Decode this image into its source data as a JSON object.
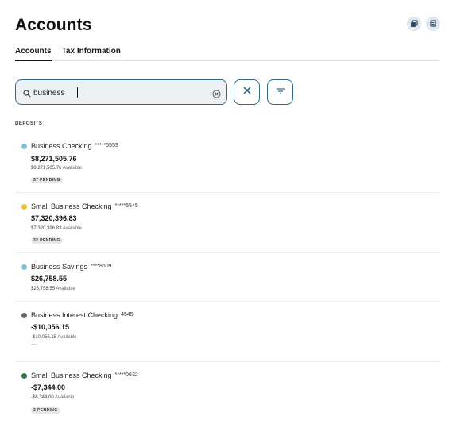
{
  "header": {
    "title": "Accounts",
    "icons": [
      "copy-icon",
      "print-icon"
    ]
  },
  "tabs": [
    {
      "label": "Accounts",
      "active": true
    },
    {
      "label": "Tax Information",
      "active": false
    }
  ],
  "search": {
    "value": "business",
    "icon": "search-icon",
    "clear_icon": "clear-circle-icon"
  },
  "actions": {
    "close_icon": "close-icon",
    "filter_icon": "filter-icon"
  },
  "section": {
    "label": "DEPOSITS"
  },
  "accounts": [
    {
      "name": "Business Checking",
      "mask": "*****5553",
      "balance": "$8,271,505.76",
      "available": "$8,271,505.76",
      "available_label": "Available",
      "pending": "37 PENDING",
      "dot_color": "#7cc4dc"
    },
    {
      "name": "Small Business Checking",
      "mask": "*****5545",
      "balance": "$7,320,396.83",
      "available": "$7,320,396.83",
      "available_label": "Available",
      "pending": "32 PENDING",
      "dot_color": "#f0c22e"
    },
    {
      "name": "Business Savings",
      "mask": "****8509",
      "balance": "$26,758.55",
      "available": "$26,758.55",
      "available_label": "Available",
      "pending": "",
      "dot_color": "#7cc4dc"
    },
    {
      "name": "Business Interest Checking",
      "mask": "4545",
      "balance": "-$10,056.15",
      "available": "-$10,056.15",
      "available_label": "Available",
      "pending": "",
      "extra": "---",
      "dot_color": "#666666"
    },
    {
      "name": "Small Business Checking",
      "mask": "*****0632",
      "balance": "-$7,344.00",
      "available": "-$6,344.00",
      "available_label": "Available",
      "pending": "2 PENDING",
      "dot_color": "#2a7a43"
    }
  ],
  "colors": {
    "accent": "#2f6b86",
    "search_bg": "#eef1f3"
  }
}
